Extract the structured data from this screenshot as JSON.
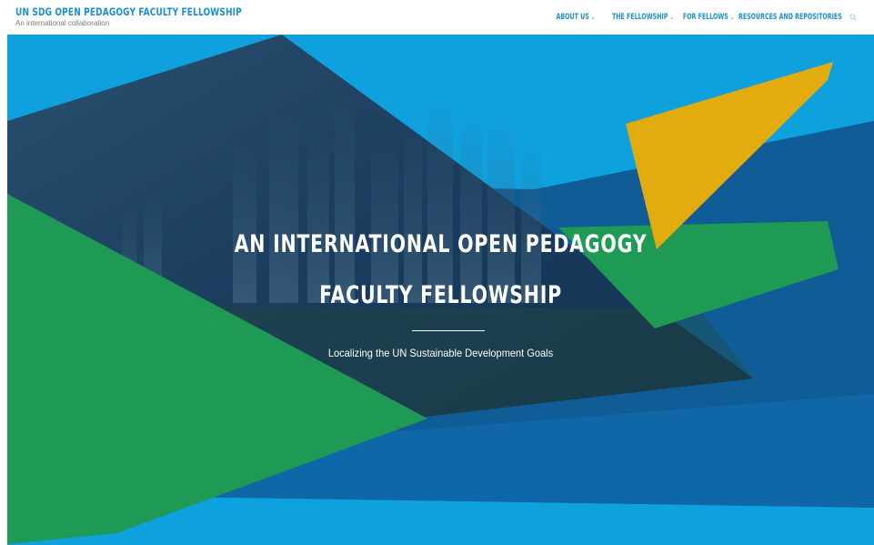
{
  "header": {
    "site_title": "UN SDG OPEN PEDAGOGY FACULTY FELLOWSHIP",
    "tagline": "An international collaboration",
    "nav": [
      {
        "label": "ABOUT US",
        "has_dropdown": true
      },
      {
        "label": "THE FELLOWSHIP",
        "has_dropdown": true
      },
      {
        "label": "FOR FELLOWS",
        "has_dropdown": true
      },
      {
        "label": "RESOURCES AND REPOSITORIES",
        "has_dropdown": false
      }
    ],
    "search_icon": "search-icon"
  },
  "hero": {
    "title_line1": "AN INTERNATIONAL OPEN PEDAGOGY",
    "title_line2": "FACULTY FELLOWSHIP",
    "subtitle": "Localizing the UN Sustainable Development Goals"
  },
  "colors": {
    "brand_blue": "#1b8fd1",
    "light_blue": "#0fa0de",
    "dark_blue": "#0f5c96",
    "navy": "#16365a",
    "green": "#1f9a55",
    "yellow": "#e3ac0e"
  }
}
